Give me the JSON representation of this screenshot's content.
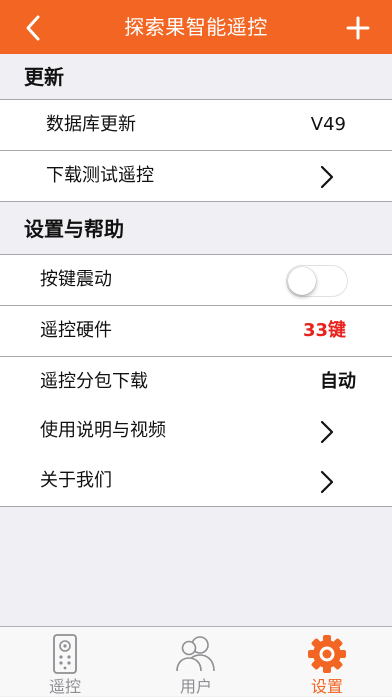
{
  "nav": {
    "title": "探索果智能遥控",
    "accent": "#f26522"
  },
  "sections": {
    "update": {
      "header": "更新",
      "db_label": "数据库更新",
      "db_value": "V49",
      "download_label": "下载测试遥控"
    },
    "settings": {
      "header": "设置与帮助",
      "vibration_label": "按键震动",
      "vibration_on": false,
      "hardware_label": "遥控硬件",
      "hardware_value": "33键",
      "hardware_color": "#e8221c",
      "subpkg_label": "遥控分包下载",
      "subpkg_value": "自动",
      "manual_label": "使用说明与视频",
      "about_label": "关于我们"
    }
  },
  "tabbar": {
    "remote": "遥控",
    "user": "用户",
    "settings": "设置",
    "active": "settings"
  }
}
